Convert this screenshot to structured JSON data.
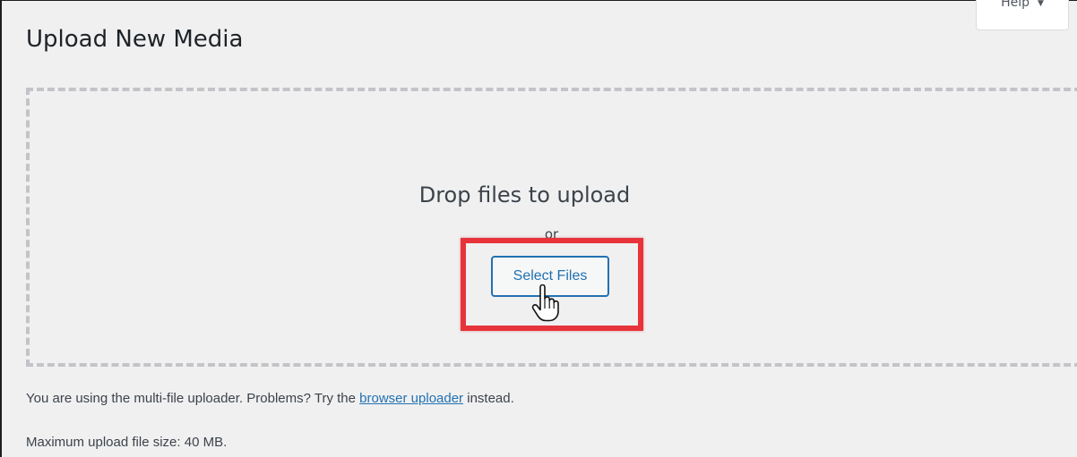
{
  "header": {
    "title": "Upload New Media",
    "help_label": "Help",
    "help_caret_icon": "caret-down-icon"
  },
  "uploader": {
    "drop_instructions": "Drop files to upload",
    "or_text": "or",
    "select_files_label": "Select Files",
    "cursor_icon": "hand-pointer-icon",
    "highlight_color": "#e8333a"
  },
  "info": {
    "multi_prefix": "You are using the multi-file uploader. Problems? Try the",
    "browser_uploader_link": "browser uploader",
    "multi_suffix": "instead.",
    "max_size": "Maximum upload file size: 40 MB."
  },
  "colors": {
    "background": "#f0f0f1",
    "accent": "#2271b1",
    "dashed_border": "#c3c4c7"
  }
}
